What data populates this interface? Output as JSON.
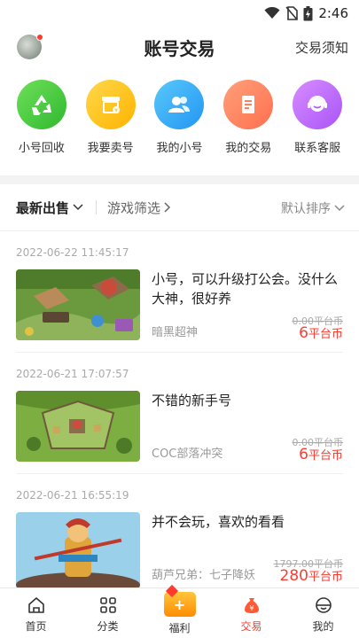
{
  "status_bar": {
    "time": "2:46"
  },
  "header": {
    "title": "账号交易",
    "link": "交易须知"
  },
  "quick_actions": [
    {
      "label": "小号回收",
      "icon": "recycle-icon",
      "color": "#4cd137"
    },
    {
      "label": "我要卖号",
      "icon": "shop-icon",
      "color": "#ffc312"
    },
    {
      "label": "我的小号",
      "icon": "users-icon",
      "color": "#34b7f1"
    },
    {
      "label": "我的交易",
      "icon": "receipt-icon",
      "color": "#ff7e5f"
    },
    {
      "label": "联系客服",
      "icon": "support-icon",
      "color": "#c56cf0"
    }
  ],
  "filters": {
    "main": "最新出售",
    "game": "游戏筛选",
    "sort": "默认排序"
  },
  "listings": [
    {
      "date": "2022-06-22 11:45:17",
      "title": "小号，可以升级打公会。没什么大神，很好养",
      "game": "暗黑超神",
      "old_price": "0.00平台币",
      "price": "6",
      "unit": "平台币"
    },
    {
      "date": "2022-06-21 17:07:57",
      "title": "不错的新手号",
      "game": "COC部落冲突",
      "old_price": "0.00平台币",
      "price": "6",
      "unit": "平台币"
    },
    {
      "date": "2022-06-21 16:55:19",
      "title": "并不会玩，喜欢的看看",
      "game": "葫芦兄弟：七子降妖",
      "old_price": "1797.00平台币",
      "price": "280",
      "unit": "平台币"
    }
  ],
  "tabs": [
    {
      "label": "首页"
    },
    {
      "label": "分类"
    },
    {
      "label": "福利"
    },
    {
      "label": "交易"
    },
    {
      "label": "我的"
    }
  ]
}
